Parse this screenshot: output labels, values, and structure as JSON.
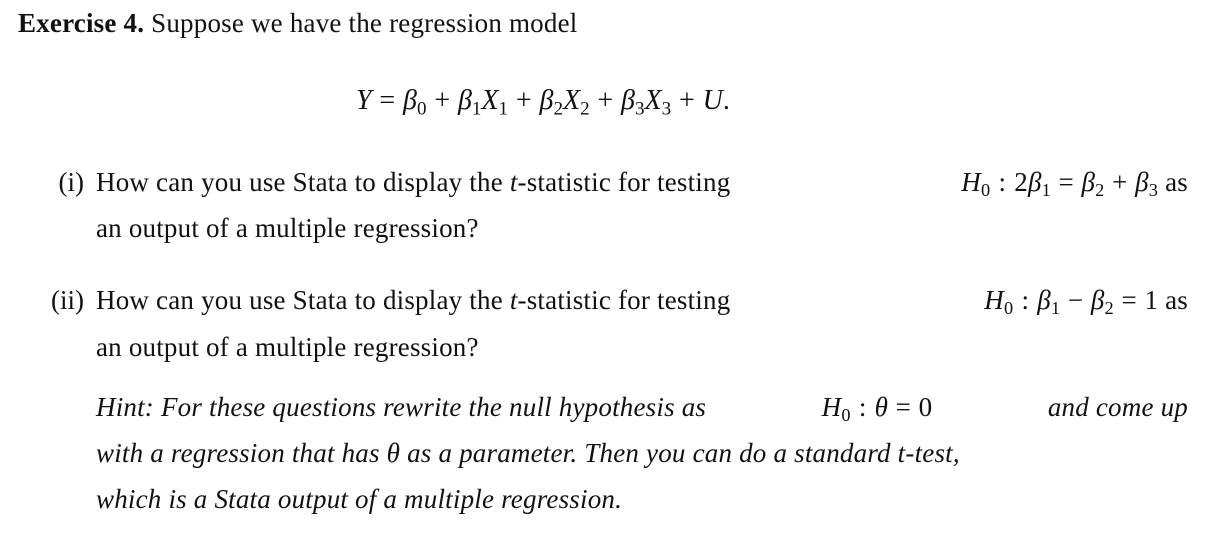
{
  "exercise": {
    "label": "Exercise 4.",
    "intro": "Suppose we have the regression model"
  },
  "equation": {
    "lhs": "Y",
    "equals": "=",
    "terms": [
      {
        "coef": "β",
        "coef_sub": "0",
        "var": "",
        "var_sub": ""
      },
      {
        "coef": "β",
        "coef_sub": "1",
        "var": "X",
        "var_sub": "1"
      },
      {
        "coef": "β",
        "coef_sub": "2",
        "var": "X",
        "var_sub": "2"
      },
      {
        "coef": "β",
        "coef_sub": "3",
        "var": "X",
        "var_sub": "3"
      }
    ],
    "plus": "+",
    "error": "U",
    "end": "."
  },
  "items": [
    {
      "label": "(i)",
      "line1_text": "How can you use Stata to display the",
      "t_var": "t",
      "line1_text2": "-statistic for testing",
      "hyp": {
        "H": "H",
        "H_sub": "0",
        "colon": ":",
        "lhs_num": "2",
        "lhs_beta": "β",
        "lhs_sub": "1",
        "eq": "=",
        "r1_beta": "β",
        "r1_sub": "2",
        "op": "+",
        "r2_beta": "β",
        "r2_sub": "3"
      },
      "line1_tail": "as",
      "line2": "an output of a multiple regression?"
    },
    {
      "label": "(ii)",
      "line1_text": "How can you use Stata to display the",
      "t_var": "t",
      "line1_text2": "-statistic for testing",
      "hyp": {
        "H": "H",
        "H_sub": "0",
        "colon": ":",
        "l_beta": "β",
        "l_sub": "1",
        "op": "−",
        "r_beta": "β",
        "r_sub": "2",
        "eq": "=",
        "val": "1"
      },
      "line1_tail": "as",
      "line2": "an output of a multiple regression?"
    }
  ],
  "hint": {
    "line1_a": "Hint: For these questions rewrite the null hypothesis as",
    "H": "H",
    "H_sub": "0",
    "colon": ":",
    "theta": "θ",
    "eq": "=",
    "zero": "0",
    "line1_b": "and come up",
    "line2_a": "with a regression that has",
    "theta2": "θ",
    "line2_b": "as a parameter.  Then you can do a standard t-test,",
    "line3": "which is a Stata output of a multiple regression."
  }
}
